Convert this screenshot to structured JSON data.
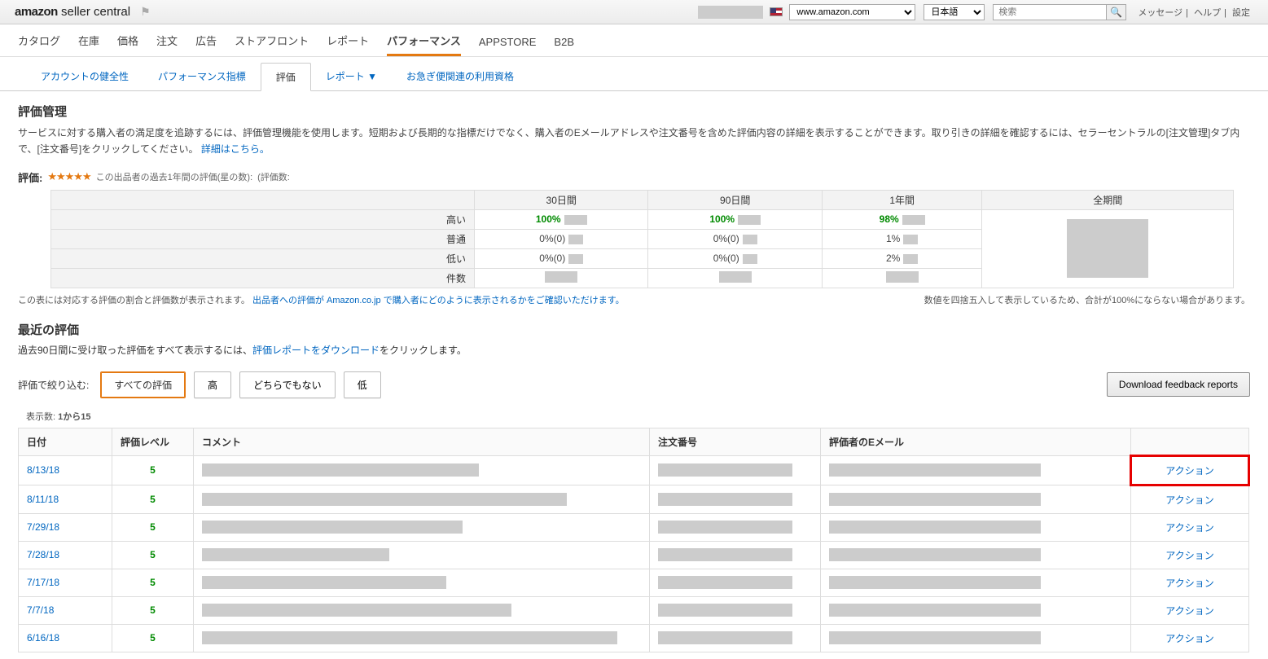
{
  "header": {
    "logo_bold": "amazon",
    "logo_rest": "seller central",
    "domain": "www.amazon.com",
    "language": "日本語",
    "search_placeholder": "検索",
    "links": {
      "messages": "メッセージ",
      "help": "ヘルプ",
      "settings": "設定"
    }
  },
  "nav": {
    "items": [
      "カタログ",
      "在庫",
      "価格",
      "注文",
      "広告",
      "ストアフロント",
      "レポート",
      "パフォーマンス",
      "APPSTORE",
      "B2B"
    ],
    "active_index": 7
  },
  "subnav": {
    "items": [
      "アカウントの健全性",
      "パフォーマンス指標",
      "評価",
      "レポート ▼",
      "お急ぎ便関連の利用資格"
    ],
    "active_index": 2
  },
  "page": {
    "title": "評価管理",
    "desc_main": "サービスに対する購入者の満足度を追跡するには、評価管理機能を使用します。短期および長期的な指標だけでなく、購入者のEメールアドレスや注文番号を含めた評価内容の詳細を表示することができます。取り引きの詳細を確認するには、セラーセントラルの[注文管理]タブ内で、[注文番号]をクリックしてください。",
    "desc_link": "詳細はこちら。"
  },
  "rating": {
    "label": "評価:",
    "sub1": "この出品者の過去1年間の評価(星の数):",
    "sub2": "(評価数:"
  },
  "summary": {
    "cols": [
      "30日間",
      "90日間",
      "1年間",
      "全期間"
    ],
    "rows": [
      {
        "label": "高い",
        "cells": [
          "100%",
          "100%",
          "98%"
        ],
        "green": true
      },
      {
        "label": "普通",
        "cells": [
          "0%(0)",
          "0%(0)",
          "1%"
        ],
        "green": false
      },
      {
        "label": "低い",
        "cells": [
          "0%(0)",
          "0%(0)",
          "2%"
        ],
        "green": false
      },
      {
        "label": "件数",
        "cells": [
          "",
          "",
          ""
        ],
        "green": false
      }
    ],
    "foot_left_a": "この表には対応する評価の割合と評価数が表示されます。",
    "foot_left_b": "出品者への評価が",
    "foot_left_c": "Amazon.co.jp で購入者にどのように表示されるかをご確認いただけます。",
    "foot_right": "数値を四捨五入して表示しているため、合計が100%にならない場合があります。"
  },
  "recent": {
    "title": "最近の評価",
    "desc_a": "過去90日間に受け取った評価をすべて表示するには、",
    "desc_link": "評価レポートをダウンロード",
    "desc_b": "をクリックします。"
  },
  "filter": {
    "label": "評価で絞り込む:",
    "buttons": [
      "すべての評価",
      "高",
      "どちらでもない",
      "低"
    ],
    "download": "Download feedback reports"
  },
  "count": {
    "prefix": "表示数:",
    "range": "1から15"
  },
  "fb": {
    "headers": {
      "date": "日付",
      "level": "評価レベル",
      "comment": "コメント",
      "order": "注文番号",
      "email": "評価者のEメール",
      "action": ""
    },
    "action_label": "アクション",
    "rows": [
      {
        "date": "8/13/18",
        "level": "5",
        "cw": 340,
        "highlight": true
      },
      {
        "date": "8/11/18",
        "level": "5",
        "cw": 448
      },
      {
        "date": "7/29/18",
        "level": "5",
        "cw": 320
      },
      {
        "date": "7/28/18",
        "level": "5",
        "cw": 230
      },
      {
        "date": "7/17/18",
        "level": "5",
        "cw": 300
      },
      {
        "date": "7/7/18",
        "level": "5",
        "cw": 380
      },
      {
        "date": "6/16/18",
        "level": "5",
        "cw": 510
      }
    ]
  }
}
